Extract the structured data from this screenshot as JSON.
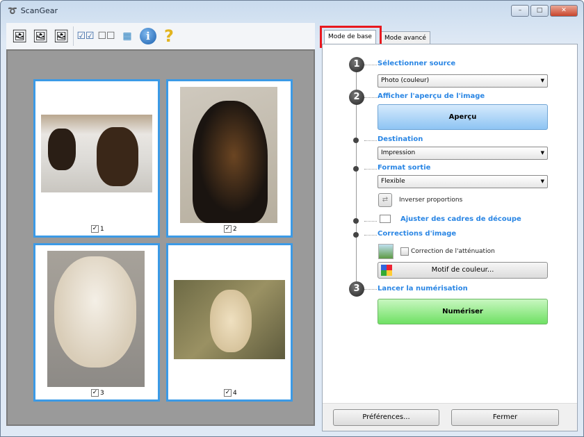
{
  "window": {
    "title": "ScanGear",
    "minimize": "–",
    "maximize": "□",
    "close": "✕"
  },
  "toolbar": {
    "icons": [
      "rotate-left-icon",
      "rotate-right-icon",
      "flip-icon",
      "select-all-icon",
      "deselect-all-icon",
      "thumbnail-view-icon",
      "info-icon",
      "help-icon"
    ]
  },
  "thumbnails": [
    {
      "label": "1",
      "checked": true
    },
    {
      "label": "2",
      "checked": true
    },
    {
      "label": "3",
      "checked": true
    },
    {
      "label": "4",
      "checked": true
    }
  ],
  "tabs": {
    "basic": "Mode de base",
    "advanced": "Mode avancé"
  },
  "steps": {
    "s1": "1",
    "s2": "2",
    "s3": "3"
  },
  "panel": {
    "select_source_label": "Sélectionner source",
    "source_value": "Photo (couleur)",
    "preview_label": "Afficher l'aperçu de l'image",
    "preview_button": "Aperçu",
    "destination_label": "Destination",
    "destination_value": "Impression",
    "output_size_label": "Format sortie",
    "output_size_value": "Flexible",
    "invert_ratio": "Inverser proportions",
    "adjust_crop": "Ajuster des cadres de découpe",
    "corrections_label": "Corrections d'image",
    "fading_correction": "Correction de l'atténuation",
    "color_pattern": "Motif de couleur...",
    "start_scan_label": "Lancer la numérisation",
    "scan_button": "Numériser"
  },
  "footer": {
    "preferences": "Préférences...",
    "close": "Fermer"
  },
  "colors": {
    "accent": "#2a86e4",
    "highlight": "#e8181e",
    "frame": "#3b9ae6"
  }
}
